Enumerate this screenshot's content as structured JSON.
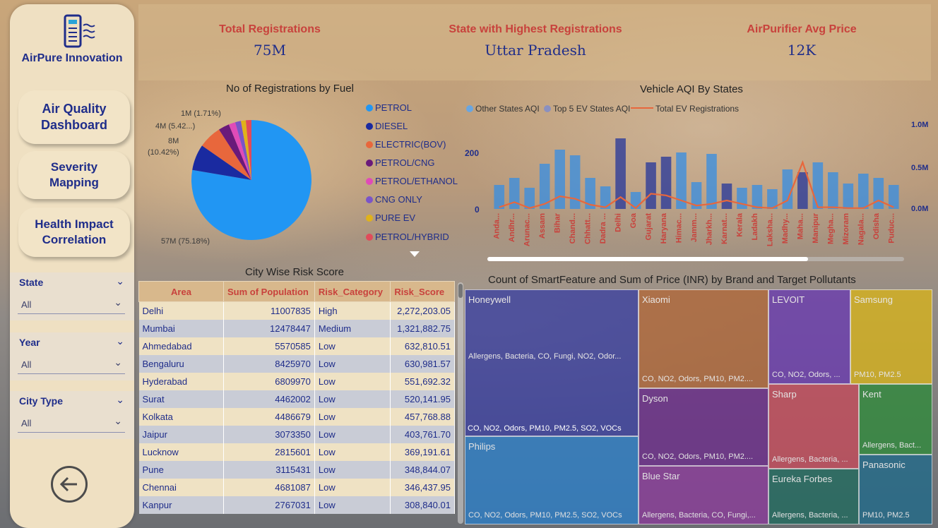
{
  "brand": {
    "name": "AirPure Innovation"
  },
  "nav": [
    {
      "line1": "Air Quality",
      "line2": "Dashboard"
    },
    {
      "line1": "Severity",
      "line2": "Mapping"
    },
    {
      "line1": "Health Impact",
      "line2": "Correlation"
    }
  ],
  "slicers": [
    {
      "label": "State",
      "value": "All"
    },
    {
      "label": "Year",
      "value": "All"
    },
    {
      "label": "City Type",
      "value": "All"
    }
  ],
  "kpis": [
    {
      "label": "Total Registrations",
      "value": "75M"
    },
    {
      "label": "State with Highest Registrations",
      "value": "Uttar Pradesh"
    },
    {
      "label": "AirPurifier Avg Price",
      "value": "12K"
    }
  ],
  "colors": {
    "petrol": "#2196F3",
    "diesel": "#1a2aa0",
    "electric": "#e8673c",
    "petrol_cng": "#6a1a7a",
    "petrol_ethanol": "#e04bb8",
    "cng_only": "#7a55c8",
    "pure_ev": "#e0b21a",
    "petrol_hybrid": "#e04b5a",
    "kpi_label": "#c8423c",
    "kpi_value": "#1f2d8a"
  },
  "fuel_chart": {
    "title": "No of Registrations by Fuel",
    "labels": {
      "petrol": "57M (75.18%)",
      "diesel": "8M",
      "diesel_pct": "(10.42%)",
      "electric": "4M (5.42...)",
      "cng": "1M (1.71%)"
    },
    "legend": [
      "PETROL",
      "DIESEL",
      "ELECTRIC(BOV)",
      "PETROL/CNG",
      "PETROL/ETHANOL",
      "CNG ONLY",
      "PURE EV",
      "PETROL/HYBRID"
    ]
  },
  "aqi_chart": {
    "title": "Vehicle AQI By States",
    "legend": [
      "Other States AQI",
      "Top 5 EV States AQI",
      "Total EV Registrations"
    ],
    "left_ticks": [
      "200",
      "0"
    ],
    "right_ticks": [
      "1.0M",
      "0.5M",
      "0.0M"
    ],
    "states": [
      "Anda...",
      "Andhr...",
      "Arunac...",
      "Assam",
      "Bihar",
      "Chand...",
      "Chhatt...",
      "Dadra ...",
      "Delhi",
      "Goa",
      "Gujarat",
      "Haryana",
      "Himac...",
      "Jamm...",
      "Jharkh...",
      "Karnat...",
      "Kerala",
      "Ladakh",
      "Laksha...",
      "Madhy...",
      "Maha...",
      "Manipur",
      "Megha...",
      "Mizoram",
      "Nagala...",
      "Odisha",
      "Puduc..."
    ]
  },
  "chart_data": {
    "type": "bar",
    "title": "Vehicle AQI By States",
    "categories": [
      "Anda...",
      "Andhr...",
      "Arunac...",
      "Assam",
      "Bihar",
      "Chand...",
      "Chhatt...",
      "Dadra ...",
      "Delhi",
      "Goa",
      "Gujarat",
      "Haryana",
      "Himac...",
      "Jamm...",
      "Jharkh...",
      "Karnat...",
      "Kerala",
      "Ladakh",
      "Laksha...",
      "Madhy...",
      "Maha...",
      "Manipur",
      "Megha...",
      "Mizoram",
      "Nagala...",
      "Odisha",
      "Puduc..."
    ],
    "series": [
      {
        "name": "Top 5 EV States AQI",
        "values": [
          85,
          110,
          75,
          160,
          210,
          190,
          110,
          80,
          250,
          60,
          165,
          185,
          200,
          95,
          195,
          90,
          75,
          85,
          70,
          140,
          130,
          165,
          130,
          90,
          125,
          110,
          85
        ]
      },
      {
        "name": "Total EV Registrations",
        "values": [
          0.02,
          0.08,
          0.01,
          0.06,
          0.15,
          0.12,
          0.05,
          0.02,
          0.14,
          0.01,
          0.18,
          0.16,
          0.1,
          0.04,
          0.06,
          0.1,
          0.06,
          0.02,
          0.01,
          0.1,
          0.55,
          0.02,
          0.02,
          0.01,
          0.01,
          0.1,
          0.02
        ]
      }
    ],
    "ylim": [
      0,
      300
    ],
    "y2lim": [
      0,
      1.0
    ]
  },
  "risk_table": {
    "title": "City Wise Risk Score",
    "headers": [
      "Area",
      "Sum of Population",
      "Risk_Category",
      "Risk_Score"
    ],
    "rows": [
      [
        "Delhi",
        "11007835",
        "High",
        "2,272,203.05"
      ],
      [
        "Mumbai",
        "12478447",
        "Medium",
        "1,321,882.75"
      ],
      [
        "Ahmedabad",
        "5570585",
        "Low",
        "632,810.51"
      ],
      [
        "Bengaluru",
        "8425970",
        "Low",
        "630,981.57"
      ],
      [
        "Hyderabad",
        "6809970",
        "Low",
        "551,692.32"
      ],
      [
        "Surat",
        "4462002",
        "Low",
        "520,141.95"
      ],
      [
        "Kolkata",
        "4486679",
        "Low",
        "457,768.88"
      ],
      [
        "Jaipur",
        "3073350",
        "Low",
        "403,761.70"
      ],
      [
        "Lucknow",
        "2815601",
        "Low",
        "369,191.61"
      ],
      [
        "Pune",
        "3115431",
        "Low",
        "348,844.07"
      ],
      [
        "Chennai",
        "4681087",
        "Low",
        "346,437.95"
      ],
      [
        "Kanpur",
        "2767031",
        "Low",
        "308,840.01"
      ]
    ]
  },
  "treemap": {
    "title": "Count of SmartFeature and Sum of Price (INR) by Brand and Target Pollutants",
    "tiles": [
      {
        "brand": "Honeywell",
        "pollutants": "Allergens, Bacteria, CO, Fungi, NO2, Odor...",
        "color": "#3a3fa0"
      },
      {
        "brand": "",
        "pollutants": "CO, NO2, Odors, PM10, PM2.5, SO2, VOCs",
        "color": "#3a3fa0"
      },
      {
        "brand": "Philips",
        "pollutants": "CO, NO2, Odors, PM10, PM2.5, SO2, VOCs",
        "color": "#2a7ec8"
      },
      {
        "brand": "Xiaomi",
        "pollutants": "CO, NO2, Odors, PM10, PM2....",
        "color": "#b26838"
      },
      {
        "brand": "Dyson",
        "pollutants": "CO, NO2, Odors, PM10, PM2....",
        "color": "#6a2a8a"
      },
      {
        "brand": "Blue Star",
        "pollutants": "Allergens, Bacteria, CO, Fungi,...",
        "color": "#8a3a9a"
      },
      {
        "brand": "LEVOIT",
        "pollutants": "CO, NO2, Odors, ...",
        "color": "#6a3ab0"
      },
      {
        "brand": "Samsung",
        "pollutants": "PM10, PM2.5",
        "color": "#d8b31a"
      },
      {
        "brand": "Sharp",
        "pollutants": "Allergens, Bacteria, ...",
        "color": "#c64a5a"
      },
      {
        "brand": "Kent",
        "pollutants": "Allergens, Bact...",
        "color": "#2e8a3a"
      },
      {
        "brand": "Eureka Forbes",
        "pollutants": "Allergens, Bacteria, ...",
        "color": "#1f6a5e"
      },
      {
        "brand": "Panasonic",
        "pollutants": "PM10, PM2.5",
        "color": "#1f6a8a"
      }
    ]
  }
}
